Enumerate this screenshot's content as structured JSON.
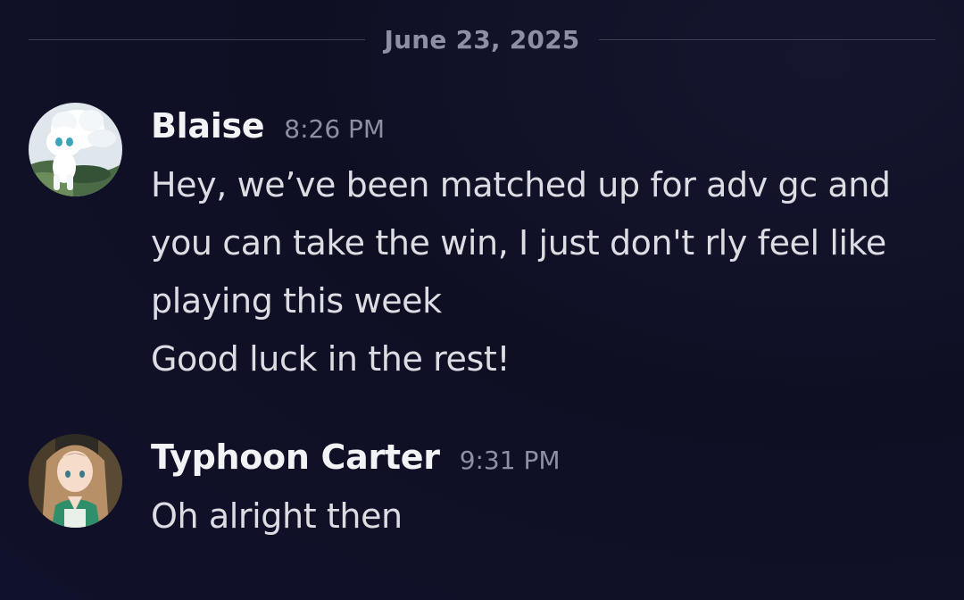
{
  "date_divider": "June 23, 2025",
  "messages": [
    {
      "author": "Blaise",
      "timestamp": "8:26 PM",
      "lines": [
        "Hey, we’ve been matched up for adv gc and",
        "you can take the win, I just don't rly feel like",
        "playing this week",
        "Good luck in the rest!"
      ],
      "avatar_icon": "vulpix-avatar"
    },
    {
      "author": "Typhoon Carter",
      "timestamp": "9:31 PM",
      "lines": [
        "Oh alright then"
      ],
      "avatar_icon": "anime-girl-avatar"
    }
  ],
  "colors": {
    "background": "#0f0f24",
    "username": "#f2f3f5",
    "message_text": "#dcdde3",
    "muted": "#8d8fa4",
    "divider_line": "#3f4058"
  }
}
